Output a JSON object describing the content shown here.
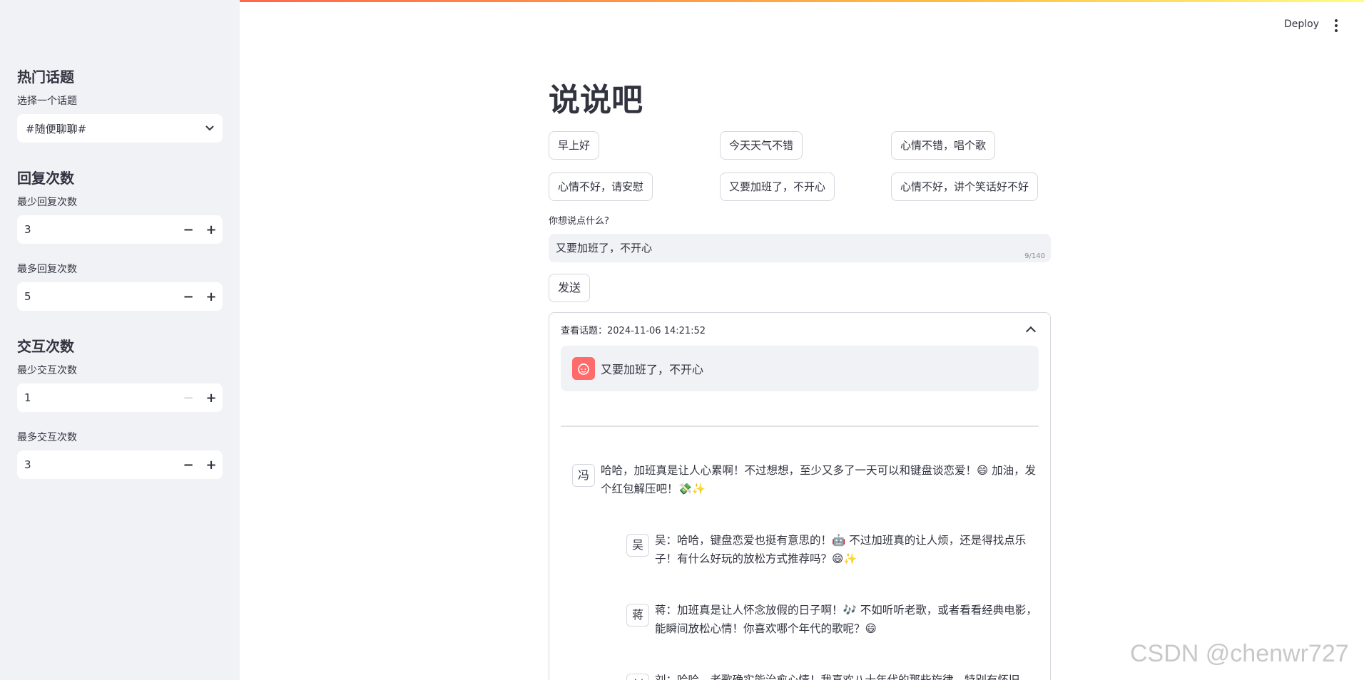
{
  "sidebar": {
    "topic_heading": "热门话题",
    "topic_label": "选择一个话题",
    "topic_value": "#随便聊聊#",
    "reply_heading": "回复次数",
    "min_reply_label": "最少回复次数",
    "min_reply_value": "3",
    "max_reply_label": "最多回复次数",
    "max_reply_value": "5",
    "interact_heading": "交互次数",
    "min_interact_label": "最少交互次数",
    "min_interact_value": "1",
    "max_interact_label": "最多交互次数",
    "max_interact_value": "3",
    "minus": "−",
    "plus": "+"
  },
  "header": {
    "deploy_label": "Deploy",
    "menu_icon": "more-vert-icon"
  },
  "main": {
    "title": "说说吧",
    "quick_buttons": [
      "早上好",
      "今天天气不错",
      "心情不错，唱个歌",
      "心情不好，请安慰",
      "又要加班了，不开心",
      "心情不好，讲个笑话好不好"
    ],
    "input_label": "你想说点什么?",
    "input_value": "又要加班了，不开心",
    "counter": "9/140",
    "send_label": "发送"
  },
  "expander": {
    "header": "查看话题：2024-11-06 14:21:52",
    "user_message": "又要加班了，不开心",
    "replies": [
      {
        "avatar": "冯",
        "text": "哈哈，加班真是让人心累啊！不过想想，至少又多了一天可以和键盘谈恋爱！😄 加油，发个红包解压吧！💸✨"
      },
      {
        "avatar": "吴",
        "text": "吴：哈哈，键盘恋爱也挺有意思的！🤖 不过加班真的让人烦，还是得找点乐子！有什么好玩的放松方式推荐吗？😄✨"
      },
      {
        "avatar": "蒋",
        "text": "蒋：加班真是让人怀念放假的日子啊！🎶 不如听听老歌，或者看看经典电影，能瞬间放松心情！你喜欢哪个年代的歌呢？😄"
      },
      {
        "avatar": "刘",
        "text": "刘：哈哈，老歌确实能治愈心情！我喜欢八十年代的那些旋律，特别有怀旧感！"
      }
    ]
  },
  "watermark": "CSDN @chenwr727"
}
